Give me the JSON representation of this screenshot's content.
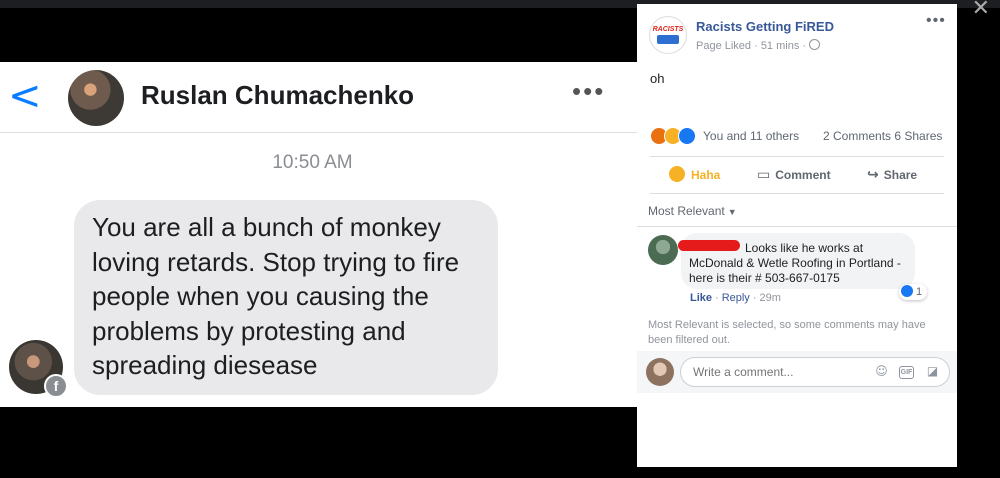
{
  "viewer": {
    "close_glyph": "✕"
  },
  "message": {
    "back_glyph": "<",
    "contact_name": "Ruslan Chumachenko",
    "more_glyph": "•••",
    "timestamp": "10:50 AM",
    "text": "You are all a bunch of monkey loving retards. Stop trying to fire people when you causing the problems by protesting and spreading diesease",
    "badge_glyph": "f"
  },
  "post": {
    "page_logo_text": "RACISTS",
    "page_name": "Racists Getting FiRED",
    "meta": "Page Liked · 51 mins · ",
    "more_glyph": "•••",
    "body": "oh",
    "reactions_text": "You and 11 others",
    "counts": "2 Comments  6 Shares",
    "haha_label": "Haha",
    "comment_label": "Comment",
    "share_label": "Share",
    "sort_label": "Most Relevant",
    "sort_caret": "▼"
  },
  "comment": {
    "text": "Looks like he works at McDonald & Wetle Roofing in Portland - here is their # 503-667-0175",
    "like_count": "1",
    "like_label": "Like",
    "reply_label": "Reply",
    "time": "29m"
  },
  "filter_note": "Most Relevant is selected, so some comments may have been filtered out.",
  "composer": {
    "placeholder": "Write a comment...",
    "gif_label": "GIF"
  },
  "colors": {
    "link": "#385898",
    "accent": "#1877f2",
    "haha": "#f7b125"
  }
}
